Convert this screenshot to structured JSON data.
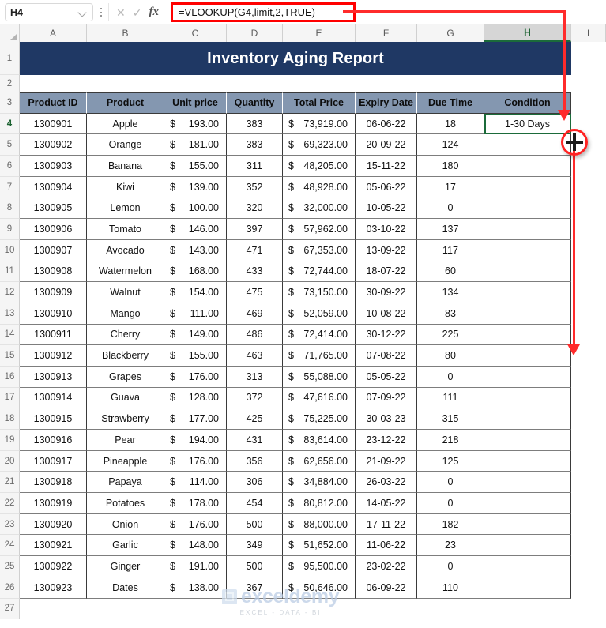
{
  "formula_bar": {
    "name_box_value": "H4",
    "formula": "=VLOOKUP(G4,limit,2,TRUE)",
    "cancel_icon": "close-icon",
    "enter_icon": "check-icon",
    "fx_icon": "fx-icon",
    "fx_label": "fx",
    "cancel_glyph": "✕",
    "enter_glyph": "✓"
  },
  "columns": [
    "A",
    "B",
    "C",
    "D",
    "E",
    "F",
    "G",
    "H",
    "I"
  ],
  "active_column": "H",
  "active_row": "4",
  "rows": [
    "1",
    "2",
    "3",
    "4",
    "5",
    "6",
    "7",
    "8",
    "9",
    "10",
    "11",
    "12",
    "13",
    "14",
    "15",
    "16",
    "17",
    "18",
    "19",
    "20",
    "21",
    "22",
    "23",
    "24",
    "25",
    "26",
    "27"
  ],
  "title": "Inventory Aging Report",
  "headers": [
    "Product ID",
    "Product",
    "Unit price",
    "Quantity",
    "Total Price",
    "Expiry Date",
    "Due Time",
    "Condition"
  ],
  "currency_symbol": "$",
  "selected_cell_value": "1-30 Days",
  "table": [
    {
      "id": "1300901",
      "product": "Apple",
      "unit_price": "193.00",
      "qty": "383",
      "total": "73,919.00",
      "expiry": "06-06-22",
      "due": "18",
      "condition": "1-30 Days"
    },
    {
      "id": "1300902",
      "product": "Orange",
      "unit_price": "181.00",
      "qty": "383",
      "total": "69,323.00",
      "expiry": "20-09-22",
      "due": "124",
      "condition": ""
    },
    {
      "id": "1300903",
      "product": "Banana",
      "unit_price": "155.00",
      "qty": "311",
      "total": "48,205.00",
      "expiry": "15-11-22",
      "due": "180",
      "condition": ""
    },
    {
      "id": "1300904",
      "product": "Kiwi",
      "unit_price": "139.00",
      "qty": "352",
      "total": "48,928.00",
      "expiry": "05-06-22",
      "due": "17",
      "condition": ""
    },
    {
      "id": "1300905",
      "product": "Lemon",
      "unit_price": "100.00",
      "qty": "320",
      "total": "32,000.00",
      "expiry": "10-05-22",
      "due": "0",
      "condition": ""
    },
    {
      "id": "1300906",
      "product": "Tomato",
      "unit_price": "146.00",
      "qty": "397",
      "total": "57,962.00",
      "expiry": "03-10-22",
      "due": "137",
      "condition": ""
    },
    {
      "id": "1300907",
      "product": "Avocado",
      "unit_price": "143.00",
      "qty": "471",
      "total": "67,353.00",
      "expiry": "13-09-22",
      "due": "117",
      "condition": ""
    },
    {
      "id": "1300908",
      "product": "Watermelon",
      "unit_price": "168.00",
      "qty": "433",
      "total": "72,744.00",
      "expiry": "18-07-22",
      "due": "60",
      "condition": ""
    },
    {
      "id": "1300909",
      "product": "Walnut",
      "unit_price": "154.00",
      "qty": "475",
      "total": "73,150.00",
      "expiry": "30-09-22",
      "due": "134",
      "condition": ""
    },
    {
      "id": "1300910",
      "product": "Mango",
      "unit_price": "111.00",
      "qty": "469",
      "total": "52,059.00",
      "expiry": "10-08-22",
      "due": "83",
      "condition": ""
    },
    {
      "id": "1300911",
      "product": "Cherry",
      "unit_price": "149.00",
      "qty": "486",
      "total": "72,414.00",
      "expiry": "30-12-22",
      "due": "225",
      "condition": ""
    },
    {
      "id": "1300912",
      "product": "Blackberry",
      "unit_price": "155.00",
      "qty": "463",
      "total": "71,765.00",
      "expiry": "07-08-22",
      "due": "80",
      "condition": ""
    },
    {
      "id": "1300913",
      "product": "Grapes",
      "unit_price": "176.00",
      "qty": "313",
      "total": "55,088.00",
      "expiry": "05-05-22",
      "due": "0",
      "condition": ""
    },
    {
      "id": "1300914",
      "product": "Guava",
      "unit_price": "128.00",
      "qty": "372",
      "total": "47,616.00",
      "expiry": "07-09-22",
      "due": "111",
      "condition": ""
    },
    {
      "id": "1300915",
      "product": "Strawberry",
      "unit_price": "177.00",
      "qty": "425",
      "total": "75,225.00",
      "expiry": "30-03-23",
      "due": "315",
      "condition": ""
    },
    {
      "id": "1300916",
      "product": "Pear",
      "unit_price": "194.00",
      "qty": "431",
      "total": "83,614.00",
      "expiry": "23-12-22",
      "due": "218",
      "condition": ""
    },
    {
      "id": "1300917",
      "product": "Pineapple",
      "unit_price": "176.00",
      "qty": "356",
      "total": "62,656.00",
      "expiry": "21-09-22",
      "due": "125",
      "condition": ""
    },
    {
      "id": "1300918",
      "product": "Papaya",
      "unit_price": "114.00",
      "qty": "306",
      "total": "34,884.00",
      "expiry": "26-03-22",
      "due": "0",
      "condition": ""
    },
    {
      "id": "1300919",
      "product": "Potatoes",
      "unit_price": "178.00",
      "qty": "454",
      "total": "80,812.00",
      "expiry": "14-05-22",
      "due": "0",
      "condition": ""
    },
    {
      "id": "1300920",
      "product": "Onion",
      "unit_price": "176.00",
      "qty": "500",
      "total": "88,000.00",
      "expiry": "17-11-22",
      "due": "182",
      "condition": ""
    },
    {
      "id": "1300921",
      "product": "Garlic",
      "unit_price": "148.00",
      "qty": "349",
      "total": "51,652.00",
      "expiry": "11-06-22",
      "due": "23",
      "condition": ""
    },
    {
      "id": "1300922",
      "product": "Ginger",
      "unit_price": "191.00",
      "qty": "500",
      "total": "95,500.00",
      "expiry": "23-02-22",
      "due": "0",
      "condition": ""
    },
    {
      "id": "1300923",
      "product": "Dates",
      "unit_price": "138.00",
      "qty": "367",
      "total": "50,646.00",
      "expiry": "06-09-22",
      "due": "110",
      "condition": ""
    }
  ],
  "watermark": {
    "brand": "exceldemy",
    "tagline": "EXCEL - DATA - BI"
  },
  "annotation": {
    "color": "#ff2b2b",
    "cursor_icon": "fill-handle-crosshair-icon",
    "highlight_icon": "circle-highlight-icon"
  }
}
